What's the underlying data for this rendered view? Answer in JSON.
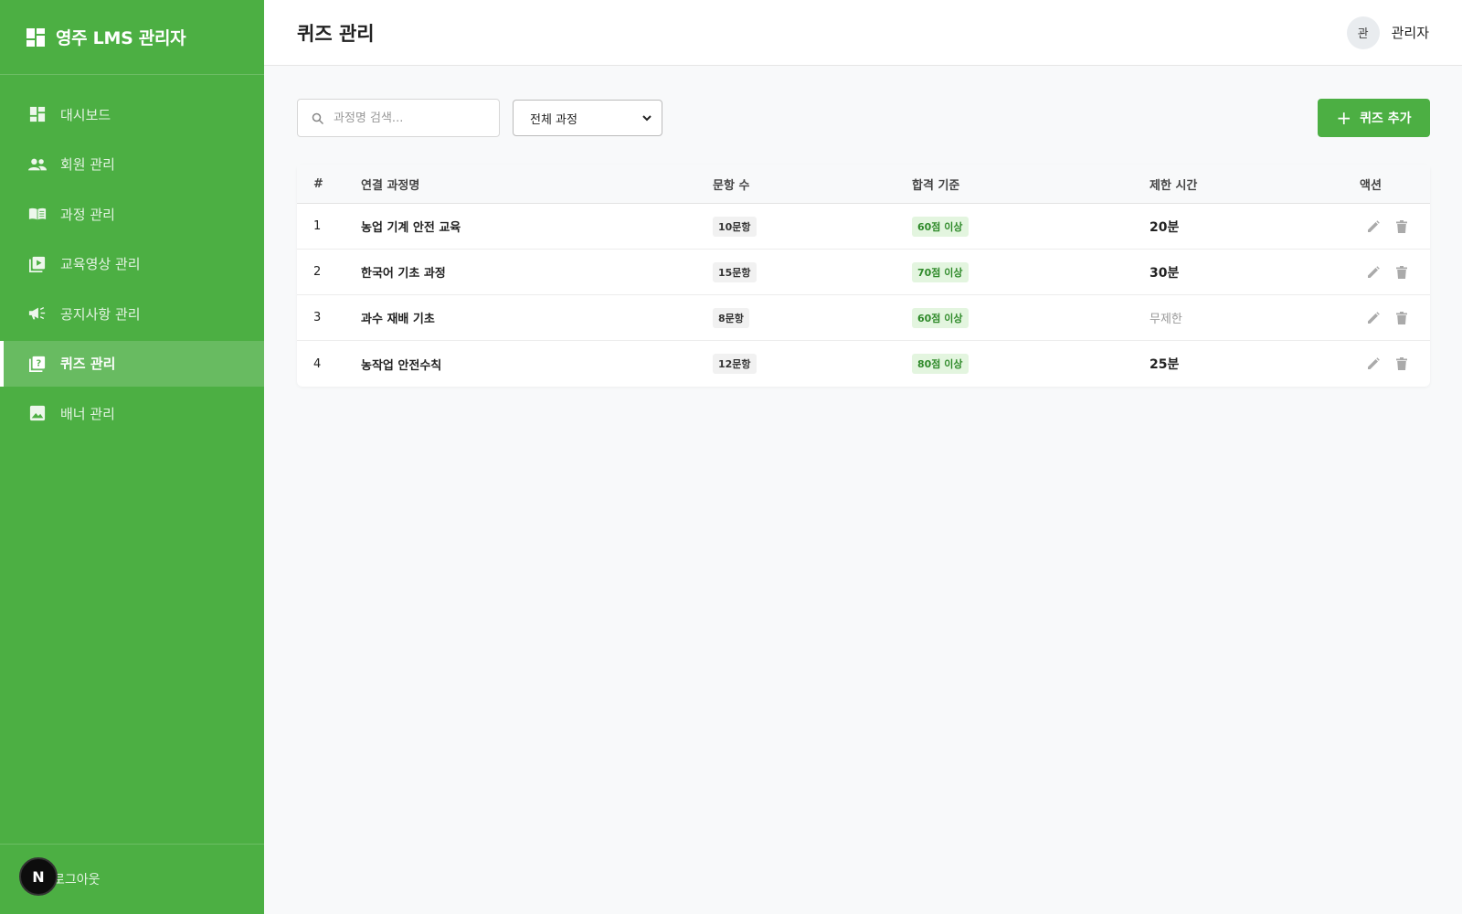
{
  "app": {
    "title": "영주 LMS 관리자"
  },
  "sidebar": {
    "items": [
      {
        "label": "대시보드",
        "icon": "dashboard-icon",
        "active": false
      },
      {
        "label": "회원 관리",
        "icon": "people-icon",
        "active": false
      },
      {
        "label": "과정 관리",
        "icon": "book-icon",
        "active": false
      },
      {
        "label": "교육영상 관리",
        "icon": "video-library-icon",
        "active": false
      },
      {
        "label": "공지사항 관리",
        "icon": "megaphone-icon",
        "active": false
      },
      {
        "label": "퀴즈 관리",
        "icon": "quiz-icon",
        "active": true
      },
      {
        "label": "배너 관리",
        "icon": "image-icon",
        "active": false
      }
    ],
    "logout_label": "로그아웃",
    "dev_badge": "N"
  },
  "header": {
    "page_title": "퀴즈 관리",
    "avatar_text": "관",
    "user_name": "관리자"
  },
  "toolbar": {
    "search_placeholder": "과정명 검색...",
    "filter_selected": "전체 과정",
    "add_label": "퀴즈 추가",
    "add_icon": "+"
  },
  "table": {
    "headers": [
      "#",
      "연결 과정명",
      "문항 수",
      "합격 기준",
      "제한 시간",
      "액션"
    ],
    "rows": [
      {
        "num": "1",
        "course": "농업 기계 안전 교육",
        "count": "10문항",
        "pass": "60점 이상",
        "time": "20분",
        "time_muted": false
      },
      {
        "num": "2",
        "course": "한국어 기초 과정",
        "count": "15문항",
        "pass": "70점 이상",
        "time": "30분",
        "time_muted": false
      },
      {
        "num": "3",
        "course": "과수 재배 기초",
        "count": "8문항",
        "pass": "60점 이상",
        "time": "무제한",
        "time_muted": true
      },
      {
        "num": "4",
        "course": "농작업 안전수칙",
        "count": "12문항",
        "pass": "80점 이상",
        "time": "25분",
        "time_muted": false
      }
    ]
  },
  "colors": {
    "brand": "#4caf43",
    "pass_badge_bg": "#e3f5df",
    "pass_badge_text": "#2f8a2a"
  }
}
